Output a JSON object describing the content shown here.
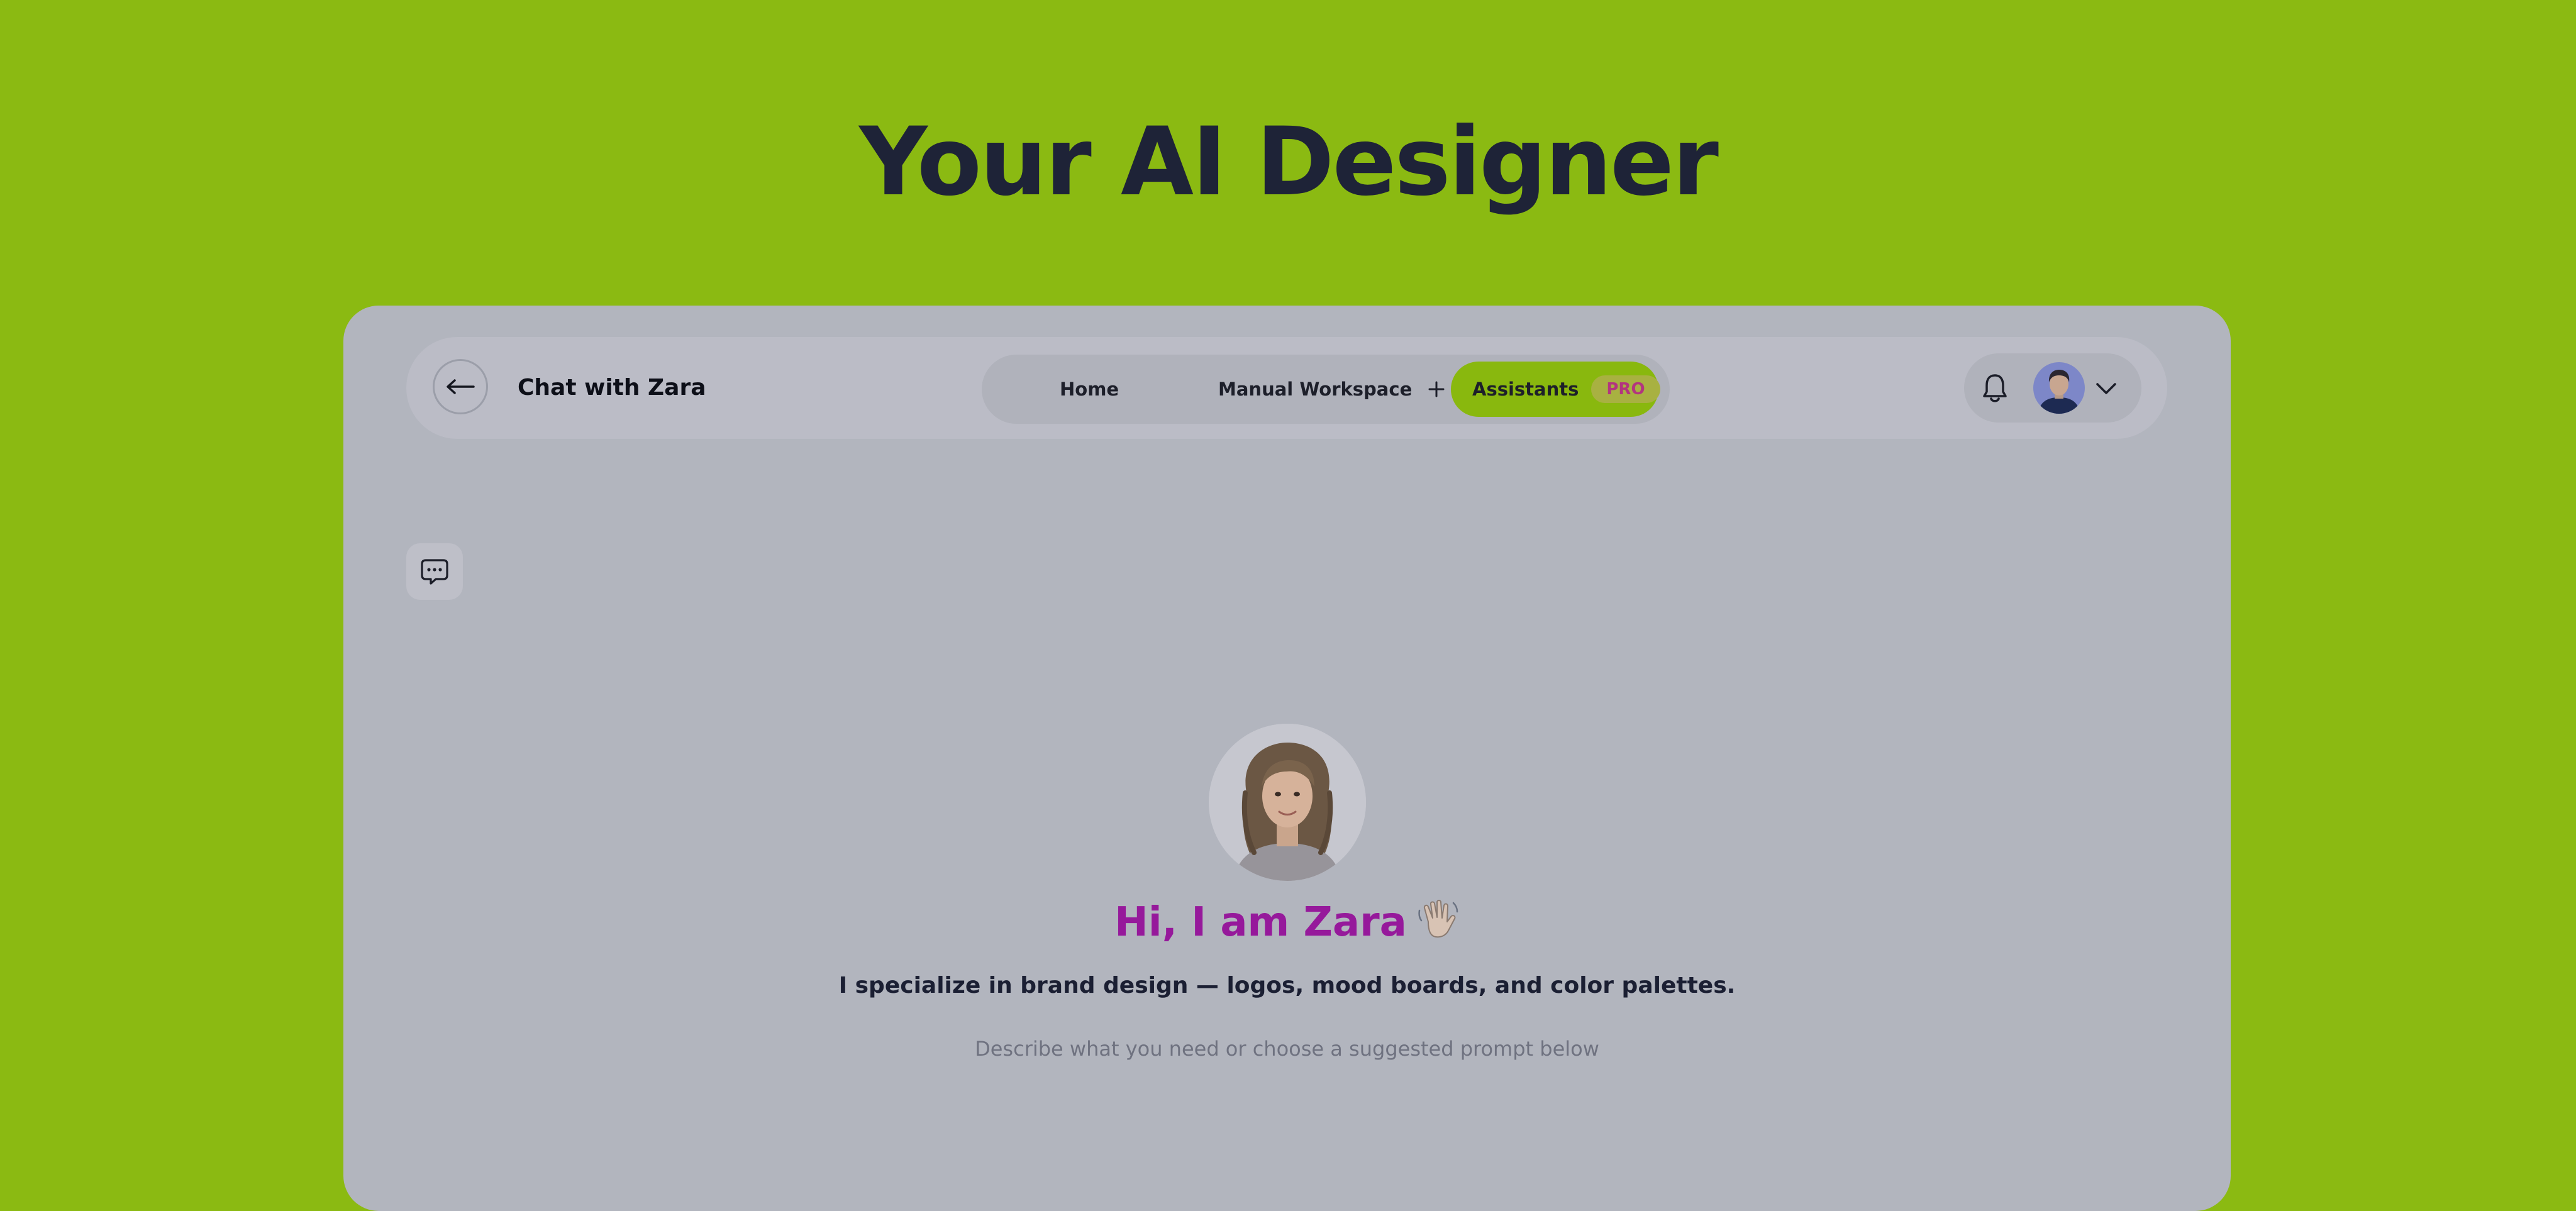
{
  "hero": {
    "title": "Your AI Designer"
  },
  "header": {
    "back_icon": "arrow-left-icon",
    "title": "Chat with Zara"
  },
  "nav": {
    "tabs": [
      {
        "label": "Home"
      },
      {
        "label": "Manual Workspace",
        "icon": "plus-icon"
      },
      {
        "label": "Assistants",
        "badge": "PRO",
        "active": true
      }
    ]
  },
  "user_controls": {
    "bell_icon": "bell-icon",
    "avatar": "user-avatar",
    "chevron_icon": "chevron-down-icon"
  },
  "sidebar": {
    "chat_history_icon": "chat-bubble-icon"
  },
  "assistant": {
    "greeting": "Hi, I am Zara",
    "greeting_emoji": "👋🏻",
    "specialty": "I specialize in brand design — logos, mood boards, and color palettes.",
    "prompt_hint": "Describe what you need or choose a suggested prompt below"
  },
  "colors": {
    "page_background": "#8bba12",
    "accent": "#89b80e",
    "greeting": "#96199b",
    "pro_badge_text": "#b3357f",
    "window": "#b2b5be"
  }
}
